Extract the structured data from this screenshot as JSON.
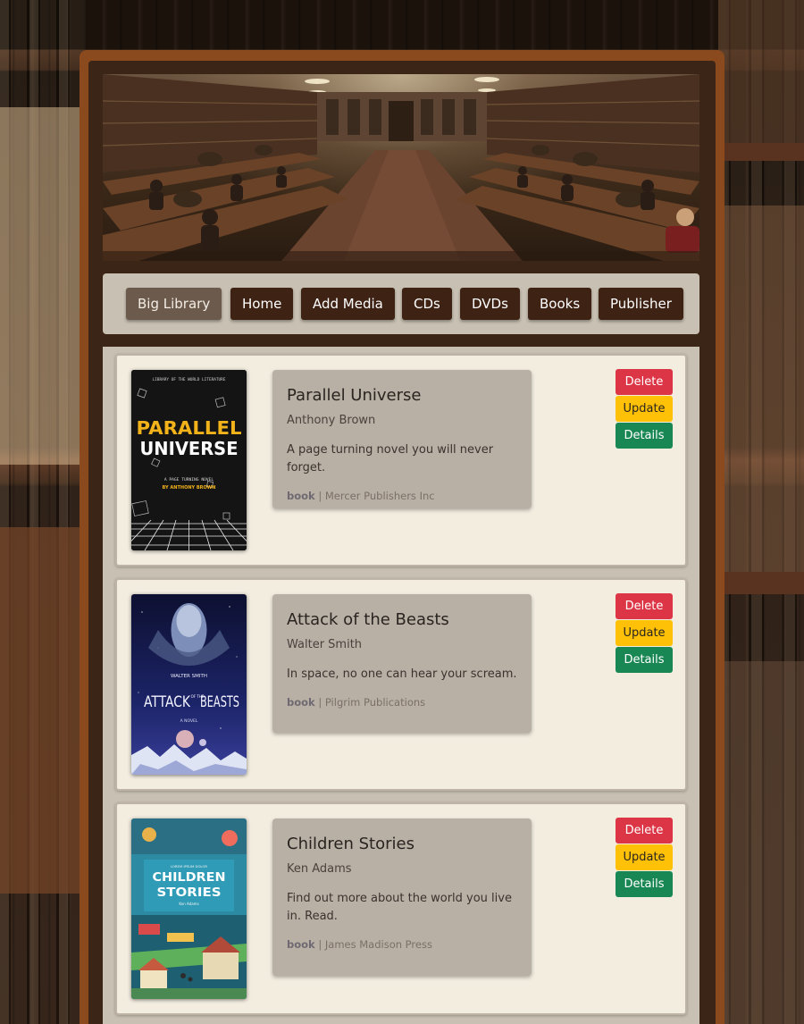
{
  "navbar": {
    "brand": "Big Library",
    "links": [
      "Home",
      "Add Media",
      "CDs",
      "DVDs",
      "Books",
      "Publisher"
    ]
  },
  "actions": {
    "delete": "Delete",
    "update": "Update",
    "details": "Details"
  },
  "items": [
    {
      "title": "Parallel Universe",
      "author": "Anthony Brown",
      "description": "A page turning novel you will never forget.",
      "type": "book",
      "separator": " | ",
      "publisher": "Mercer Publishers Inc",
      "cover": {
        "top_text": "LIBRARY OF THE WORLD LITERATURE",
        "line1": "PARALLEL",
        "line2": "UNIVERSE",
        "tagline": "A PAGE TURNING NOVEL",
        "byline": "BY ANTHONY BROWN"
      }
    },
    {
      "title": "Attack of the Beasts",
      "author": "Walter Smith",
      "description": "In space, no one can hear your scream.",
      "type": "book",
      "separator": " | ",
      "publisher": "Pilgrim Publications",
      "cover": {
        "author": "WALTER SMITH",
        "line1": "ATTACK",
        "small": "OF THE",
        "line2": "BEASTS",
        "tagline": "A NOVEL"
      }
    },
    {
      "title": "Children Stories",
      "author": "Ken Adams",
      "description": "Find out more about the world you live in. Read.",
      "type": "book",
      "separator": " | ",
      "publisher": "James Madison Press",
      "cover": {
        "top_text": "LOREM IPSUM DOLOR",
        "line1": "CHILDREN",
        "line2": "STORIES",
        "byline": "Ken Adams"
      }
    }
  ],
  "colors": {
    "frame": "#8a4a1e",
    "nav_button": "#3e2214",
    "brand_button": "#6c5a4d",
    "card_bg": "#f3ede0",
    "info_bg": "#b8afa5",
    "delete": "#dc3545",
    "update": "#ffc107",
    "details": "#198754"
  }
}
